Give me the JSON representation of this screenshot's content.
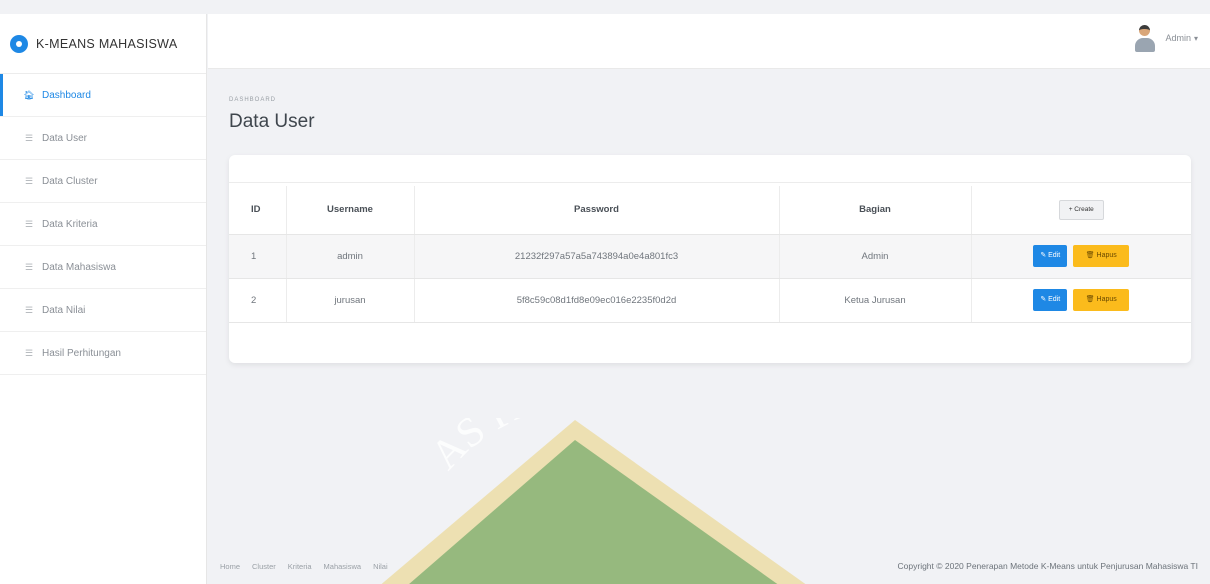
{
  "brand": {
    "title": "K-MEANS MAHASISWA"
  },
  "sidebar": {
    "items": [
      {
        "label": "Dashboard",
        "icon": "home-icon"
      },
      {
        "label": "Data User",
        "icon": "list-icon"
      },
      {
        "label": "Data Cluster",
        "icon": "list-icon"
      },
      {
        "label": "Data Kriteria",
        "icon": "list-icon"
      },
      {
        "label": "Data Mahasiswa",
        "icon": "list-icon"
      },
      {
        "label": "Data Nilai",
        "icon": "list-icon"
      },
      {
        "label": "Hasil Perhitungan",
        "icon": "list-icon"
      }
    ]
  },
  "topbar": {
    "user_name": "Admin",
    "caret": "▾"
  },
  "page": {
    "breadcrumb": "DASHBOARD",
    "title": "Data User"
  },
  "table": {
    "headers": {
      "id": "ID",
      "username": "Username",
      "password": "Password",
      "bagian": "Bagian"
    },
    "create_label": "+ Create",
    "edit_label": "✎ Edit",
    "hapus_label": "🗑 Hapus",
    "rows": [
      {
        "id": "1",
        "username": "admin",
        "password": "21232f297a57a5a743894a0e4a801fc3",
        "bagian": "Admin"
      },
      {
        "id": "2",
        "username": "jurusan",
        "password": "5f8c59c08d1fd8e09ec016e2235f0d2d",
        "bagian": "Ketua Jurusan"
      }
    ]
  },
  "watermark": {
    "text": "AS PALA"
  },
  "footer": {
    "links": [
      "Home",
      "Cluster",
      "Kriteria",
      "Mahasiswa",
      "Nilai"
    ],
    "copyright": "Copyright © 2020 Penerapan Metode K-Means untuk Penjurusan Mahasiswa TI"
  },
  "colors": {
    "primary": "#1e88e5",
    "warning": "#fbbb1c",
    "watermark_green": "#2e8b3a",
    "watermark_yellow": "#f3d23b"
  }
}
